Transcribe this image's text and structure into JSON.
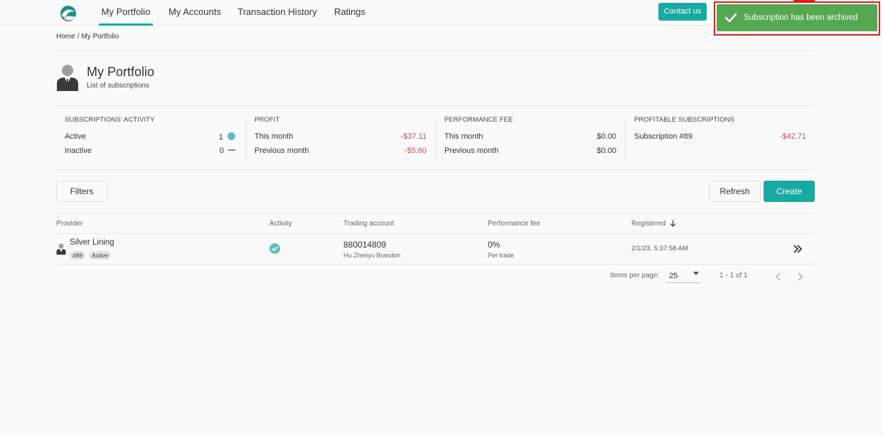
{
  "nav": {
    "tabs": [
      {
        "label": "My Portfolio",
        "active": true
      },
      {
        "label": "My Accounts"
      },
      {
        "label": "Transaction History"
      },
      {
        "label": "Ratings"
      }
    ],
    "contact_label": "Contact us"
  },
  "toast": {
    "message": "Subscription has been archived",
    "color": "#55a751"
  },
  "breadcrumb": {
    "home": "Home",
    "separator": "/",
    "current": "My Portfolio"
  },
  "header": {
    "title": "My Portfolio",
    "subtitle": "List of subscriptions"
  },
  "stats": {
    "activity": {
      "heading": "SUBSCRIPTIONS' ACTIVITY",
      "active_label": "Active",
      "active_count": "1",
      "inactive_label": "Inactive",
      "inactive_count": "0"
    },
    "profit": {
      "heading": "PROFIT",
      "this_month_label": "This month",
      "this_month_value": "-$37.11",
      "prev_month_label": "Previous month",
      "prev_month_value": "-$5.60"
    },
    "perf_fee": {
      "heading": "PERFORMANCE FEE",
      "this_month_label": "This month",
      "this_month_value": "$0.00",
      "prev_month_label": "Previous month",
      "prev_month_value": "$0.00"
    },
    "profitable": {
      "heading": "PROFITABLE SUBSCRIPTIONS",
      "name": "Subscription #89",
      "value": "-$42.71"
    }
  },
  "toolbar": {
    "filters_label": "Filters",
    "refresh_label": "Refresh",
    "create_label": "Create"
  },
  "table": {
    "columns": [
      "Provider",
      "Activity",
      "Trading account",
      "Performance fee",
      "Registered"
    ],
    "rows": [
      {
        "provider": "Silver Lining",
        "id_chip": "#89",
        "status_chip": "Active",
        "account": "880014809",
        "account_holder": "Hu Zhenyu Brandon",
        "perf_fee": "0%",
        "perf_fee_sub": "Per trade",
        "registered": "2/1/23, 5:37:58 AM"
      }
    ]
  },
  "pagination": {
    "items_per_page_label": "Items per page:",
    "items_per_page": "25",
    "range": "1 - 1 of 1"
  },
  "colors": {
    "accent": "#17a9a2",
    "negative": "#c0504d",
    "highlight_border": "#e31b1b"
  }
}
